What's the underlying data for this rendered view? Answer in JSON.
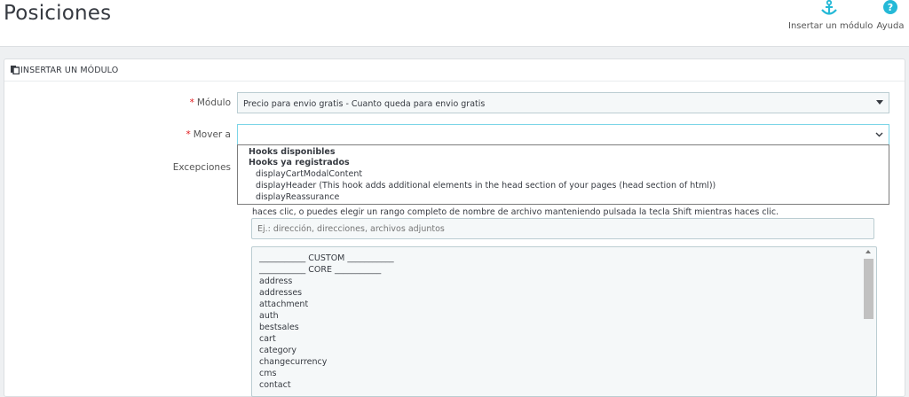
{
  "header": {
    "title": "Posiciones",
    "toolbar": {
      "insert_label": "Insertar un módulo",
      "help_label": "Ayuda"
    }
  },
  "colors": {
    "accent": "#25b9d7",
    "required": "#e0171a"
  },
  "panel": {
    "heading": "INSERTAR UN MÓDULO",
    "module_label": "Módulo",
    "module_value": "Precio para envio gratis - Cuanto queda para envio gratis",
    "move_label": "Mover a",
    "move_value": "",
    "exceptions_label": "Excepciones",
    "dropdown": {
      "groups": [
        {
          "label": "Hooks disponibles",
          "options": []
        },
        {
          "label": "Hooks ya registrados",
          "options": [
            "displayCartModalContent",
            "displayHeader (This hook adds additional elements in the head section of your pages (head section of html))",
            "displayReassurance"
          ]
        }
      ]
    },
    "help_text": "haces clic, o puedes elegir un rango completo de nombre de archivo manteniendo pulsada la tecla Shift mientras haces clic.",
    "filter_placeholder": "Ej.: dirección, direcciones, archivos adjuntos",
    "list_items": [
      "___________ CUSTOM ___________",
      "___________ CORE ___________",
      "address",
      "addresses",
      "attachment",
      "auth",
      "bestsales",
      "cart",
      "category",
      "changecurrency",
      "cms",
      "contact"
    ]
  }
}
